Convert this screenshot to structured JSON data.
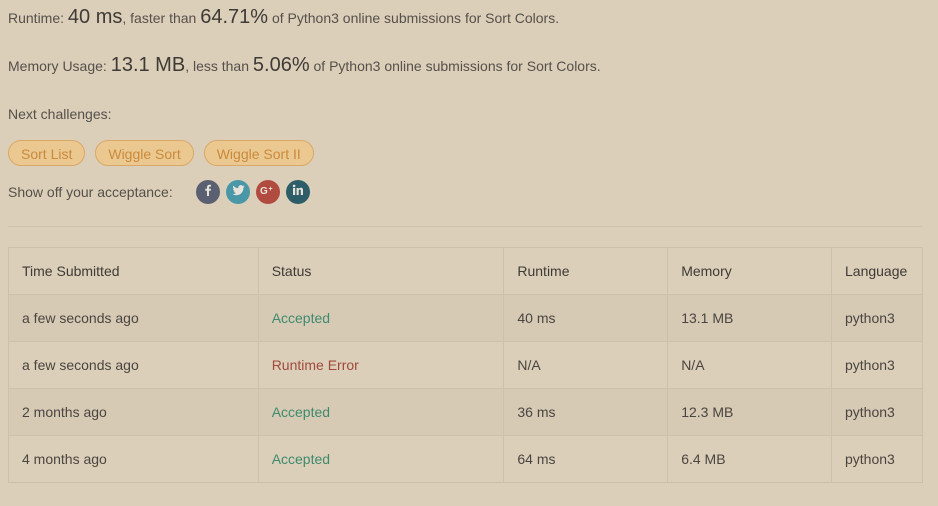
{
  "runtime_summary": {
    "label": "Runtime: ",
    "value": "40 ms",
    "mid": ", faster than ",
    "percent": "64.71%",
    "tail": " of Python3 online submissions for Sort Colors."
  },
  "memory_summary": {
    "label": "Memory Usage: ",
    "value": "13.1 MB",
    "mid": ", less than ",
    "percent": "5.06%",
    "tail": " of Python3 online submissions for Sort Colors."
  },
  "next_challenges": {
    "label": "Next challenges:",
    "items": [
      "Sort List",
      "Wiggle Sort",
      "Wiggle Sort II"
    ]
  },
  "share": {
    "label": "Show off your acceptance:",
    "buttons": [
      {
        "icon": "facebook-icon",
        "color": "#5b5f72"
      },
      {
        "icon": "twitter-icon",
        "color": "#4a97a8"
      },
      {
        "icon": "google-plus-icon",
        "color": "#b14b3f"
      },
      {
        "icon": "linkedin-icon",
        "color": "#2d5e68"
      }
    ]
  },
  "submissions": {
    "headers": [
      "Time Submitted",
      "Status",
      "Runtime",
      "Memory",
      "Language"
    ],
    "rows": [
      {
        "time": "a few seconds ago",
        "status": "Accepted",
        "runtime": "40 ms",
        "memory": "13.1 MB",
        "language": "python3"
      },
      {
        "time": "a few seconds ago",
        "status": "Runtime Error",
        "runtime": "N/A",
        "memory": "N/A",
        "language": "python3"
      },
      {
        "time": "2 months ago",
        "status": "Accepted",
        "runtime": "36 ms",
        "memory": "12.3 MB",
        "language": "python3"
      },
      {
        "time": "4 months ago",
        "status": "Accepted",
        "runtime": "64 ms",
        "memory": "6.4 MB",
        "language": "python3"
      }
    ],
    "status_colors": {
      "Accepted": "#3e8a6e",
      "Runtime Error": "#a04a3c"
    }
  }
}
